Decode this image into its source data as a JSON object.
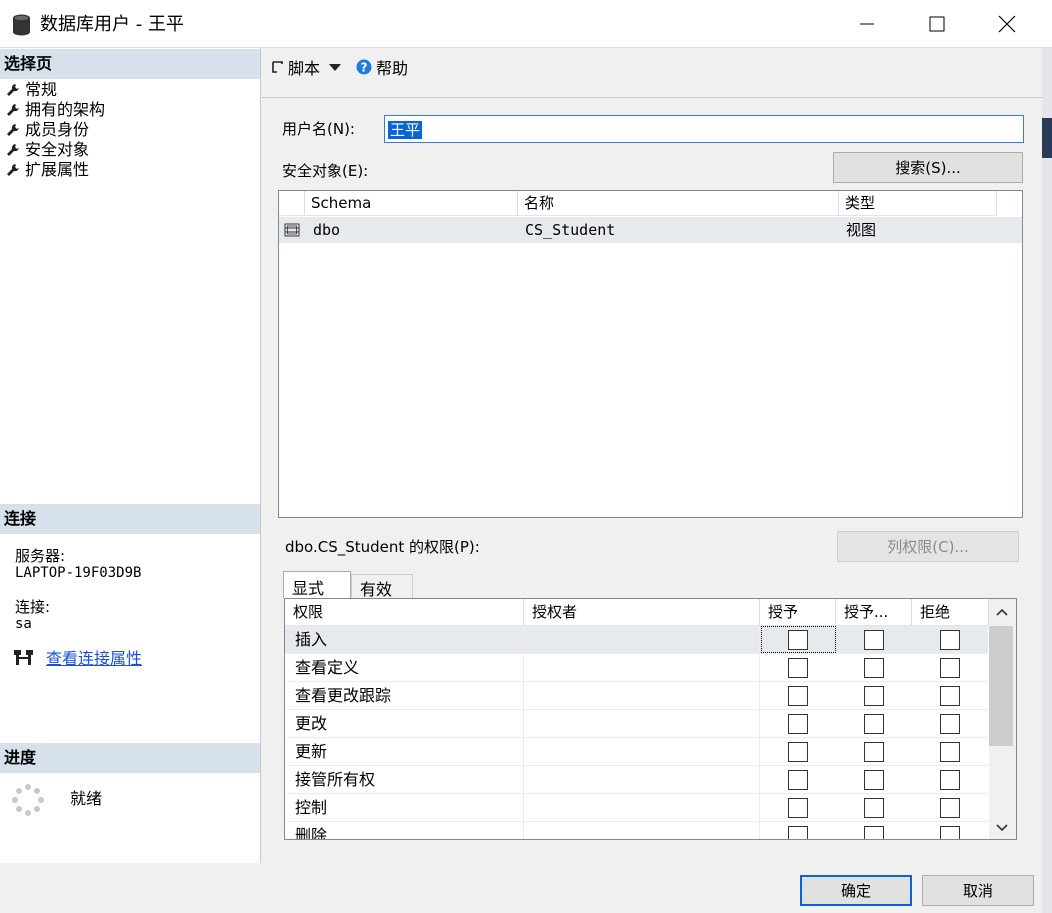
{
  "window": {
    "title": "数据库用户 - 王平"
  },
  "left": {
    "select_page_header": "选择页",
    "nav_items": [
      "常规",
      "拥有的架构",
      "成员身份",
      "安全对象",
      "扩展属性"
    ],
    "connection_header": "连接",
    "server_label": "服务器:",
    "server_value": "LAPTOP-19F03D9B",
    "connection_label": "连接:",
    "connection_value": "sa",
    "view_connection_link": "查看连接属性",
    "progress_header": "进度",
    "progress_status": "就绪"
  },
  "toolbar": {
    "script_label": "脚本",
    "help_label": "帮助"
  },
  "form": {
    "username_label": "用户名(N):",
    "username_value": "王平",
    "securables_label": "安全对象(E):",
    "search_button": "搜索(S)..."
  },
  "securables": {
    "columns": [
      "Schema",
      "名称",
      "类型"
    ],
    "rows": [
      {
        "schema": "dbo",
        "name": "CS_Student",
        "type": "视图"
      }
    ]
  },
  "permissions": {
    "label": "dbo.CS_Student 的权限(P):",
    "column_perms_button": "列权限(C)...",
    "tabs": [
      "显式",
      "有效"
    ],
    "columns": [
      "权限",
      "授权者",
      "授予",
      "授予...",
      "拒绝"
    ],
    "rows": [
      "插入",
      "查看定义",
      "查看更改跟踪",
      "更改",
      "更新",
      "接管所有权",
      "控制",
      "删除"
    ]
  },
  "buttons": {
    "ok": "确定",
    "cancel": "取消"
  }
}
